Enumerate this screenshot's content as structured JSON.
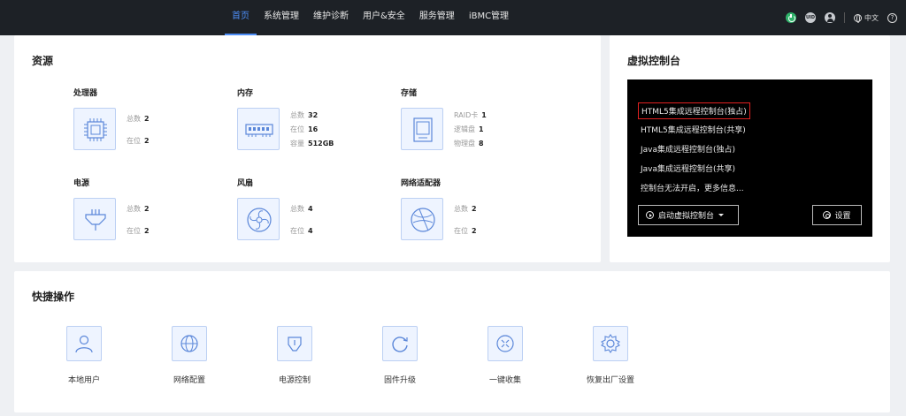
{
  "nav": {
    "items": [
      {
        "label": "首页",
        "active": true
      },
      {
        "label": "系统管理",
        "active": false
      },
      {
        "label": "维护诊断",
        "active": false
      },
      {
        "label": "用户&安全",
        "active": false
      },
      {
        "label": "服务管理",
        "active": false
      },
      {
        "label": "iBMC管理",
        "active": false
      }
    ],
    "uid_badge": "UID",
    "language": "中文",
    "help_glyph": "?"
  },
  "resources": {
    "title": "资源",
    "groups": [
      {
        "label": "处理器",
        "icon": "cpu-icon",
        "stats": [
          {
            "key": "总数",
            "value": "2"
          },
          {
            "key": "在位",
            "value": "2"
          }
        ]
      },
      {
        "label": "内存",
        "icon": "memory-icon",
        "stats": [
          {
            "key": "总数",
            "value": "32"
          },
          {
            "key": "在位",
            "value": "16"
          },
          {
            "key": "容量",
            "value": "512GB"
          }
        ]
      },
      {
        "label": "存储",
        "icon": "storage-icon",
        "stats": [
          {
            "key": "RAID卡",
            "value": "1"
          },
          {
            "key": "逻辑盘",
            "value": "1"
          },
          {
            "key": "物理盘",
            "value": "8"
          }
        ]
      },
      {
        "label": "电源",
        "icon": "power-supply-icon",
        "stats": [
          {
            "key": "总数",
            "value": "2"
          },
          {
            "key": "在位",
            "value": "2"
          }
        ]
      },
      {
        "label": "风扇",
        "icon": "fan-icon",
        "stats": [
          {
            "key": "总数",
            "value": "4"
          },
          {
            "key": "在位",
            "value": "4"
          }
        ]
      },
      {
        "label": "网络适配器",
        "icon": "network-adapter-icon",
        "stats": [
          {
            "key": "总数",
            "value": "2"
          },
          {
            "key": "在位",
            "value": "2"
          }
        ]
      }
    ]
  },
  "console": {
    "title": "虚拟控制台",
    "links": [
      "HTML5集成远程控制台(独占)",
      "HTML5集成远程控制台(共享)",
      "Java集成远程控制台(独占)",
      "Java集成远程控制台(共享)",
      "控制台无法开启，更多信息..."
    ],
    "launch_label": "启动虚拟控制台",
    "settings_label": "设置"
  },
  "quick": {
    "title": "快捷操作",
    "items": [
      {
        "label": "本地用户",
        "icon": "local-user-icon"
      },
      {
        "label": "网络配置",
        "icon": "network-config-icon"
      },
      {
        "label": "电源控制",
        "icon": "power-control-icon"
      },
      {
        "label": "固件升级",
        "icon": "firmware-upgrade-icon"
      },
      {
        "label": "一键收集",
        "icon": "one-click-collect-icon"
      },
      {
        "label": "恢复出厂设置",
        "icon": "factory-reset-icon"
      }
    ]
  }
}
